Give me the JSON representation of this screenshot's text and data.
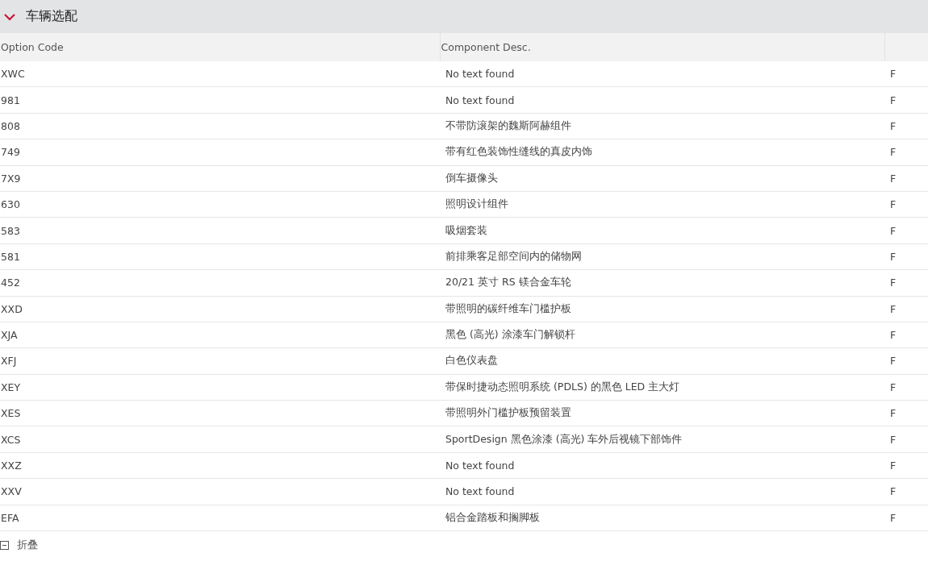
{
  "section": {
    "title": "车辆选配",
    "expanded": true
  },
  "table": {
    "columns": [
      "Option Code",
      "Component Desc."
    ],
    "rows": [
      {
        "code": "XWC",
        "desc": "No text found",
        "column_3": "F"
      },
      {
        "code": "981",
        "desc": "No text found",
        "column_3": "F"
      },
      {
        "code": "808",
        "desc": "不带防滚架的魏斯阿赫组件",
        "column_3": "F"
      },
      {
        "code": "749",
        "desc": "带有红色装饰性缝线的真皮内饰",
        "column_3": "F"
      },
      {
        "code": "7X9",
        "desc": "倒车摄像头",
        "column_3": "F"
      },
      {
        "code": "630",
        "desc": "照明设计组件",
        "column_3": "F"
      },
      {
        "code": "583",
        "desc": "吸烟套装",
        "column_3": "F"
      },
      {
        "code": "581",
        "desc": "前排乘客足部空间内的储物网",
        "column_3": "F"
      },
      {
        "code": "452",
        "desc": "20/21 英寸 RS 镁合金车轮",
        "column_3": "F"
      },
      {
        "code": "XXD",
        "desc": "带照明的碳纤维车门槛护板",
        "column_3": "F"
      },
      {
        "code": "XJA",
        "desc": "黑色 (高光) 涂漆车门解锁杆",
        "column_3": "F"
      },
      {
        "code": "XFJ",
        "desc": "白色仪表盘",
        "column_3": "F"
      },
      {
        "code": "XEY",
        "desc": "带保时捷动态照明系统 (PDLS) 的黑色 LED 主大灯",
        "column_3": "F"
      },
      {
        "code": "XES",
        "desc": "带照明外门槛护板预留装置",
        "column_3": "F"
      },
      {
        "code": "XCS",
        "desc": "SportDesign 黑色涂漆 (高光) 车外后视镜下部饰件",
        "column_3": "F"
      },
      {
        "code": "XXZ",
        "desc": "No text found",
        "column_3": "F"
      },
      {
        "code": "XXV",
        "desc": "No text found",
        "column_3": "F"
      },
      {
        "code": "EFA",
        "desc": "铝合金踏板和搁脚板",
        "column_3": "F"
      }
    ]
  },
  "collapse_button": {
    "label": "折叠"
  }
}
